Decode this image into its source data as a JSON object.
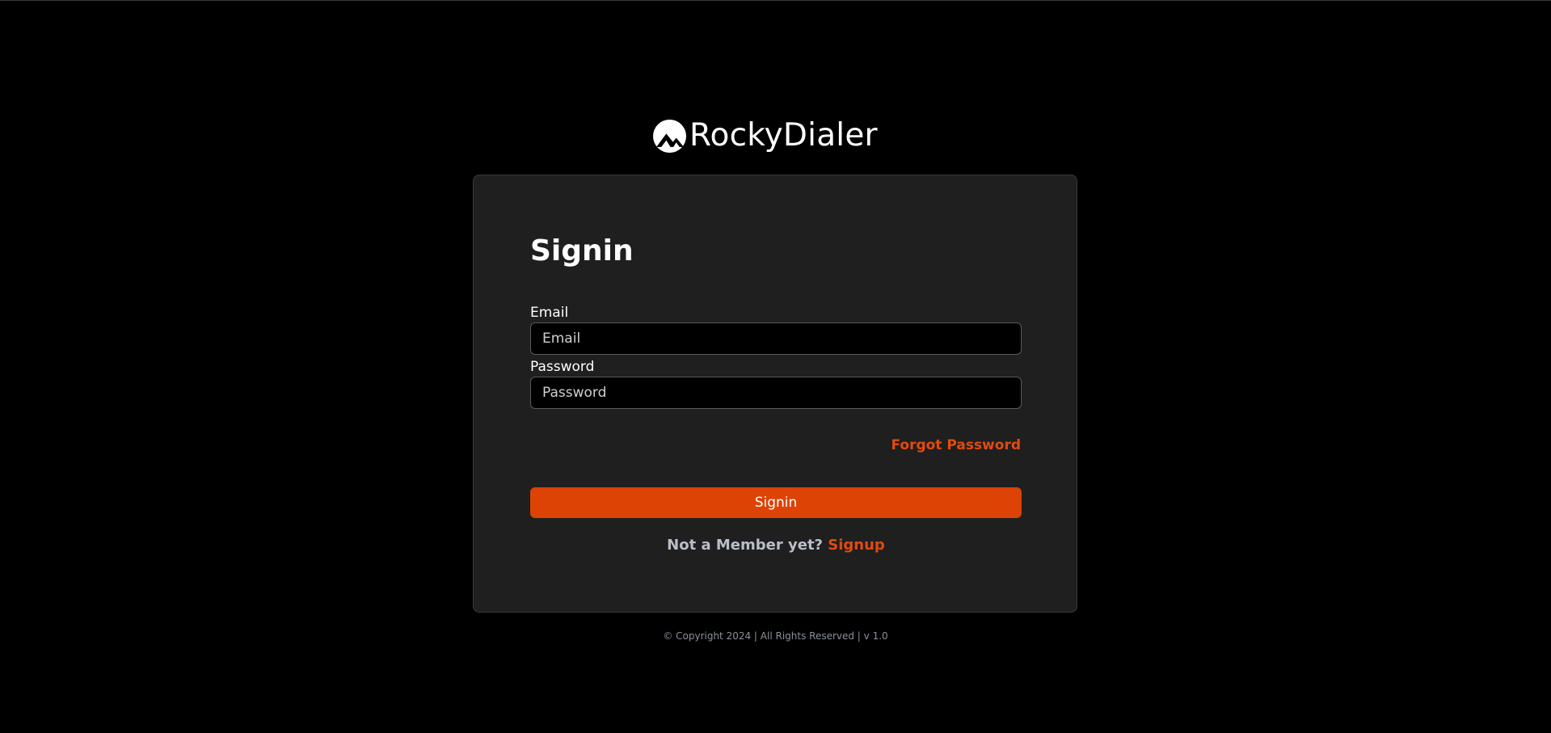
{
  "brand": {
    "name": "RockyDialer",
    "logo_icon": "mountain-circle-logo-icon"
  },
  "signin": {
    "title": "Signin",
    "email_label": "Email",
    "email_placeholder": "Email",
    "email_value": "",
    "password_label": "Password",
    "password_placeholder": "Password",
    "password_value": "",
    "forgot_password": "Forgot Password",
    "submit_label": "Signin",
    "member_prompt": "Not a Member yet?",
    "signup_link": "Signup"
  },
  "footer": {
    "text": "© Copyright 2024 | All Rights Reserved | v 1.0"
  },
  "colors": {
    "background": "#000000",
    "card": "#1f1f1f",
    "accent": "#dc4304",
    "link": "#e34a0f",
    "muted_text": "#b9bec8"
  }
}
